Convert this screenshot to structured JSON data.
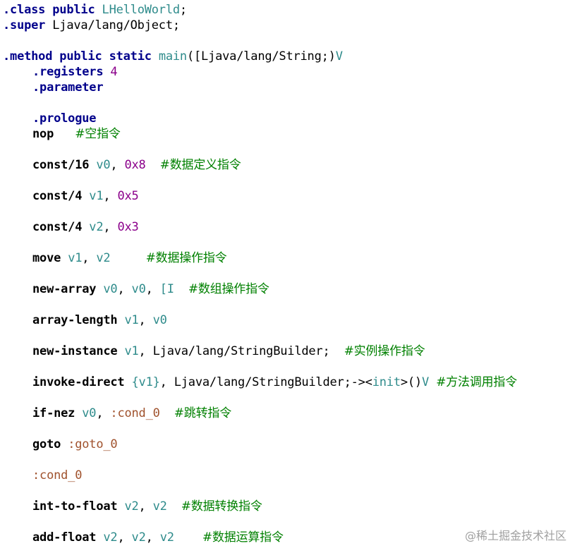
{
  "lines": {
    "l0": {
      "kw": ".class",
      "kw2": "public",
      "name": "LHelloWorld",
      "end": ";"
    },
    "l1": {
      "kw": ".super",
      "rest": "Ljava/lang/Object;"
    },
    "l2": {
      "kw": ".method",
      "kw2": "public",
      "kw3": "static",
      "name": "main",
      "params": "([Ljava/lang/String;)",
      "ret": "V"
    },
    "l3": {
      "kw": ".registers",
      "num": "4"
    },
    "l4": {
      "kw": ".parameter"
    },
    "l5": {
      "kw": ".prologue"
    },
    "l6": {
      "op": "nop",
      "cmt": "#空指令"
    },
    "l7": {
      "op": "const/16",
      "r1": "v0",
      "sep": ", ",
      "lit": "0x8",
      "cmt": "#数据定义指令"
    },
    "l8": {
      "op": "const/4",
      "r1": "v1",
      "sep": ", ",
      "lit": "0x5"
    },
    "l9": {
      "op": "const/4",
      "r1": "v2",
      "sep": ", ",
      "lit": "0x3"
    },
    "l10": {
      "op": "move",
      "r1": "v1",
      "sep": ", ",
      "r2": "v2",
      "cmt": "#数据操作指令"
    },
    "l11": {
      "op": "new-array",
      "r1": "v0",
      "sep": ", ",
      "r2": "v0",
      "sep2": ", ",
      "t": "[I",
      "cmt": "#数组操作指令"
    },
    "l12": {
      "op": "array-length",
      "r1": "v1",
      "sep": ", ",
      "r2": "v0"
    },
    "l13": {
      "op": "new-instance",
      "r1": "v1",
      "sep": ", ",
      "rest": "Ljava/lang/StringBuilder;",
      "cmt": "#实例操作指令"
    },
    "l14": {
      "op": "invoke-direct",
      "r1": "{v1}",
      "sep": ", ",
      "rest": "Ljava/lang/StringBuilder;-><",
      "m": "init",
      "rest2": ">()",
      "ret": "V",
      "cmt": "#方法调用指令"
    },
    "l15": {
      "op": "if-nez",
      "r1": "v0",
      "sep": ", ",
      "lbl": ":cond_0",
      "cmt": "#跳转指令"
    },
    "l16": {
      "op": "goto",
      "lbl": ":goto_0"
    },
    "l17": {
      "lbl": ":cond_0"
    },
    "l18": {
      "op": "int-to-float",
      "r1": "v2",
      "sep": ", ",
      "r2": "v2",
      "cmt": "#数据转换指令"
    },
    "l19": {
      "op": "add-float",
      "r1": "v2",
      "sep": ", ",
      "r2": "v2",
      "sep2": ", ",
      "r3": "v2",
      "cmt": "#数据运算指令"
    }
  },
  "watermark": "@稀土掘金技术社区",
  "colors": {
    "keyword": "#00008b",
    "register": "#2e8b8b",
    "literal": "#8b008b",
    "label": "#a0522d",
    "comment": "#008000"
  }
}
